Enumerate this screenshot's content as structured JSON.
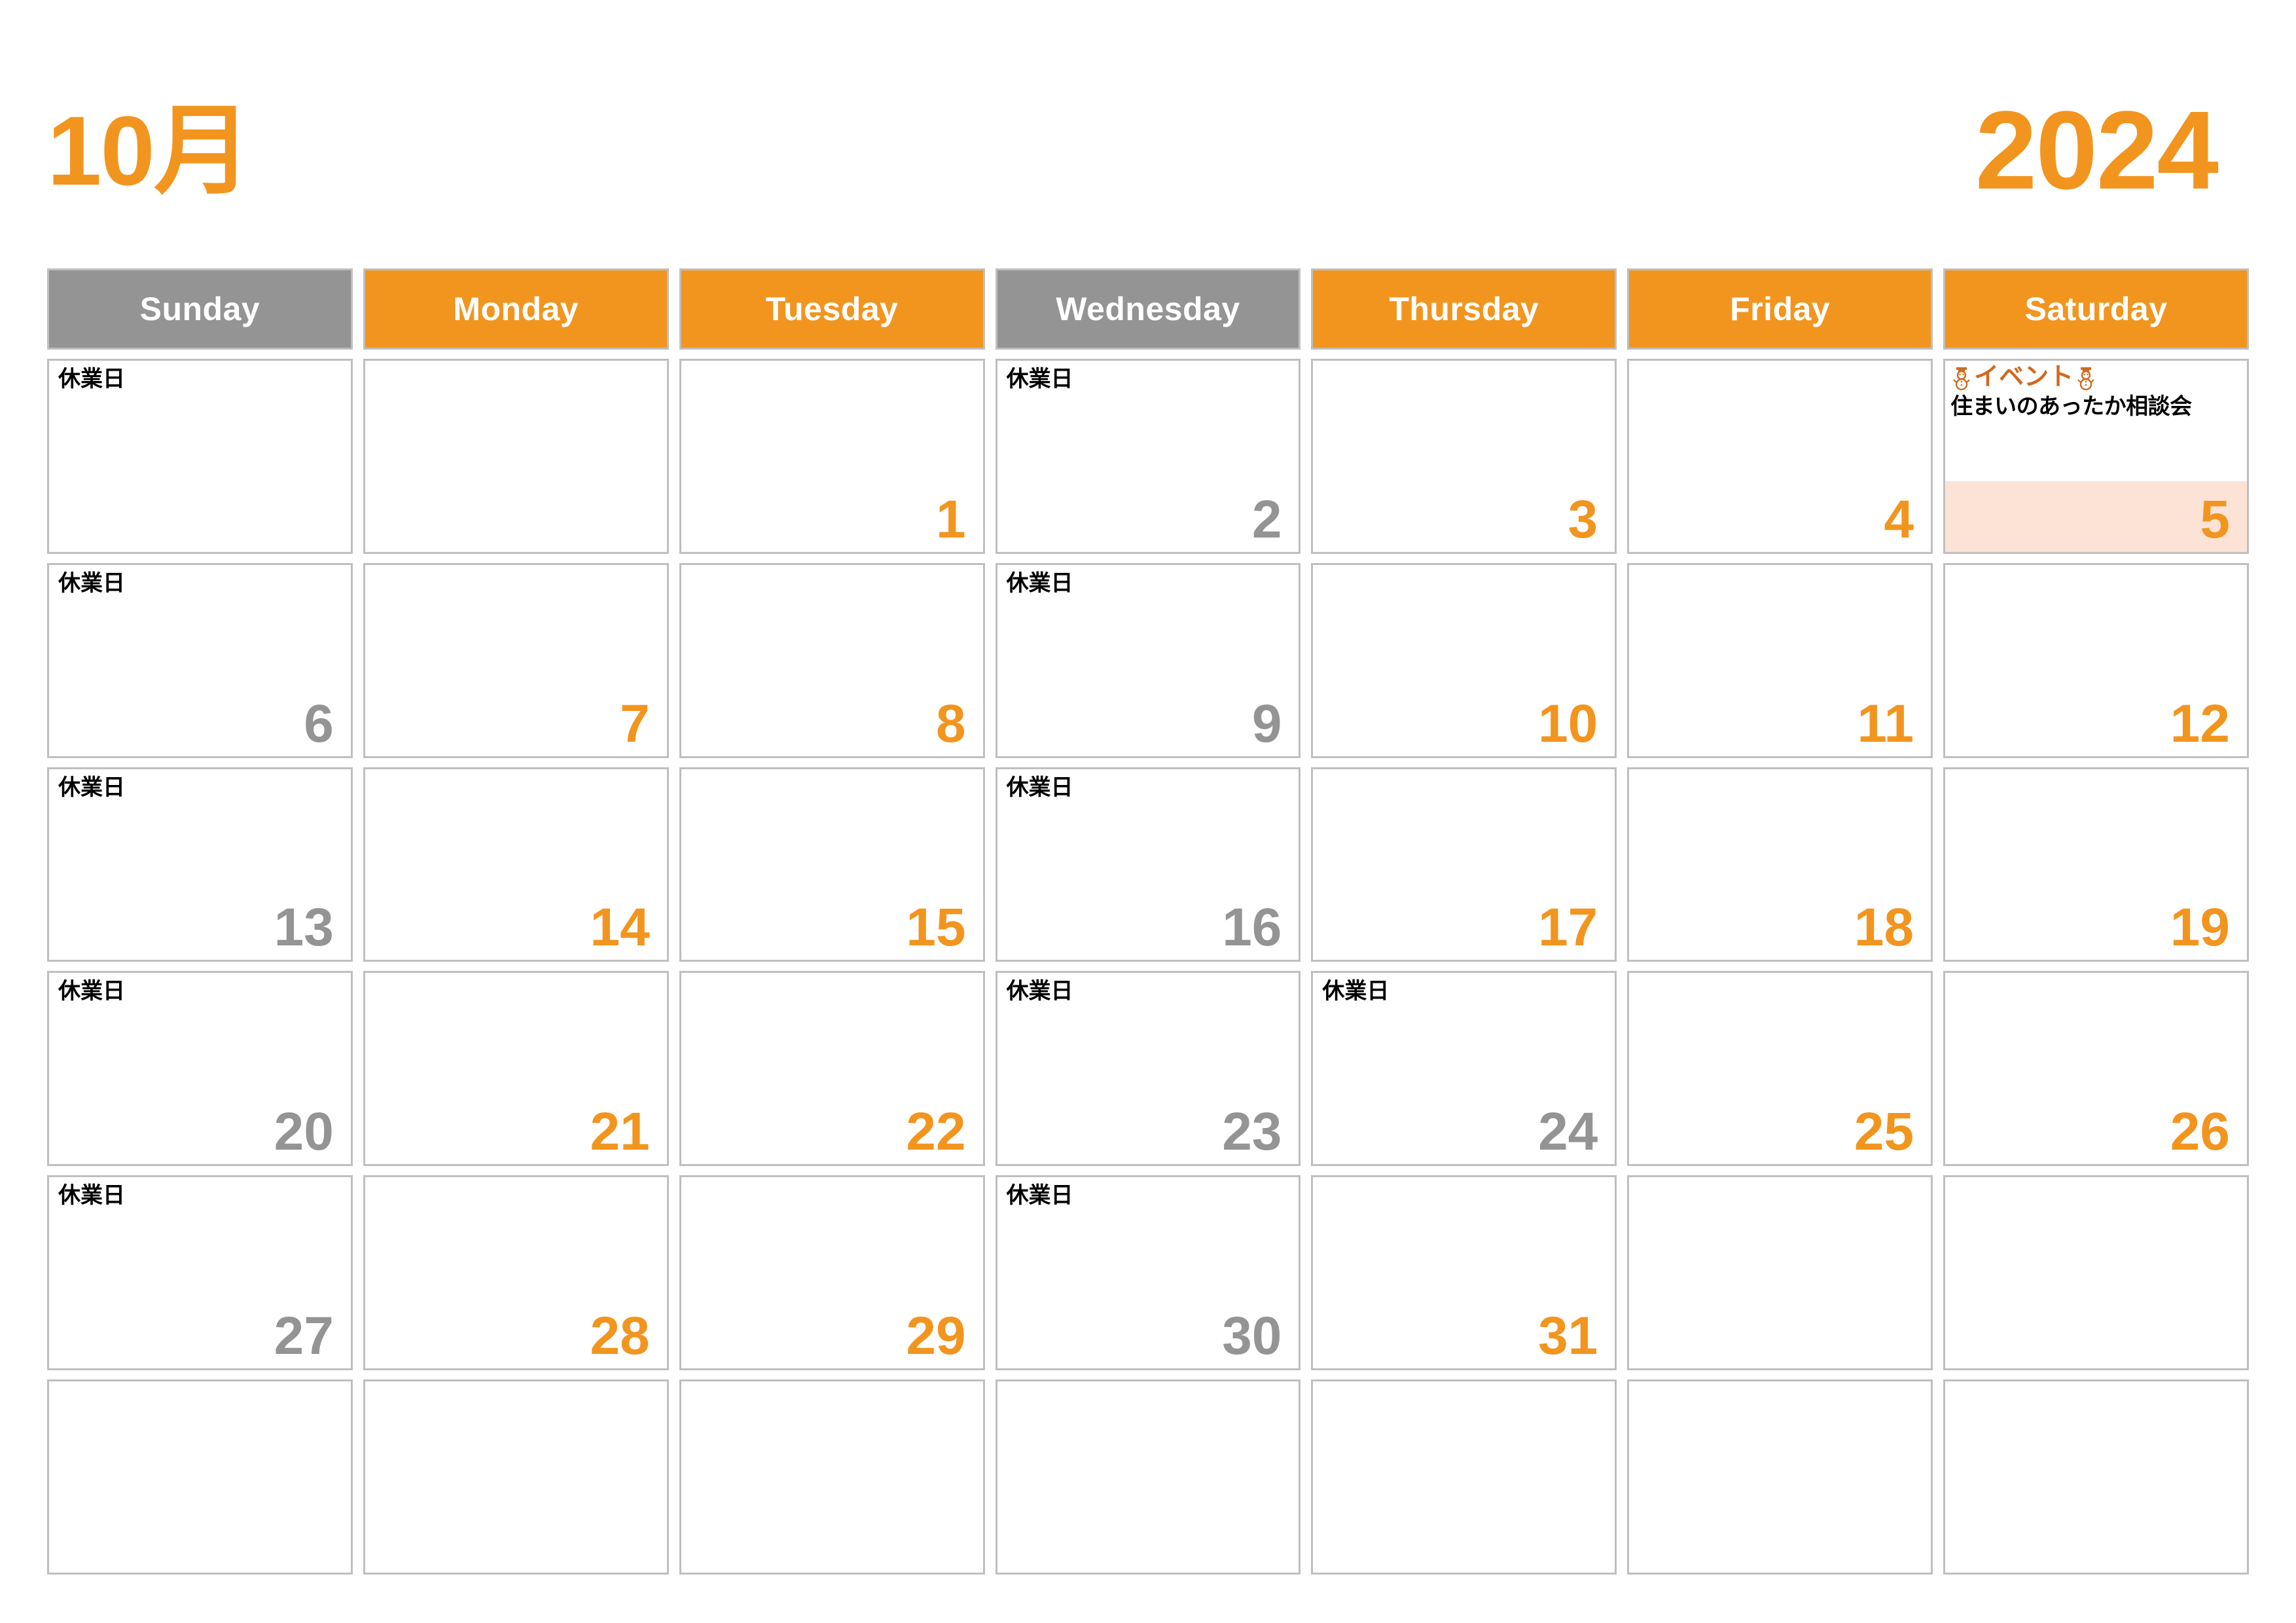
{
  "header": {
    "month_label": "10月",
    "year_label": "2024"
  },
  "weekdays": [
    {
      "label": "Sunday",
      "state": "closed"
    },
    {
      "label": "Monday",
      "state": "open"
    },
    {
      "label": "Tuesday",
      "state": "open"
    },
    {
      "label": "Wednesday",
      "state": "closed"
    },
    {
      "label": "Thursday",
      "state": "open"
    },
    {
      "label": "Friday",
      "state": "open"
    },
    {
      "label": "Saturday",
      "state": "open"
    }
  ],
  "labels": {
    "closed_day": "休業日",
    "event_tag": "イベント",
    "snowman_icon": "snowman-icon"
  },
  "colors": {
    "accent_orange": "#F2951F",
    "closed_gray": "#949494",
    "event_bg": "#FCE3D6",
    "event_tag_color": "#D2691E",
    "cell_border": "#BFBFBF"
  },
  "weeks": [
    [
      {
        "date": "",
        "color": "",
        "closed": true,
        "event": null
      },
      {
        "date": "",
        "color": "",
        "closed": false,
        "event": null
      },
      {
        "date": "1",
        "color": "orange",
        "closed": false,
        "event": null
      },
      {
        "date": "2",
        "color": "gray",
        "closed": true,
        "event": null
      },
      {
        "date": "3",
        "color": "orange",
        "closed": false,
        "event": null
      },
      {
        "date": "4",
        "color": "orange",
        "closed": false,
        "event": null
      },
      {
        "date": "5",
        "color": "orange",
        "closed": false,
        "event": {
          "tag": "イベント",
          "title": "住まいのあったか相談会"
        }
      }
    ],
    [
      {
        "date": "6",
        "color": "gray",
        "closed": true,
        "event": null
      },
      {
        "date": "7",
        "color": "orange",
        "closed": false,
        "event": null
      },
      {
        "date": "8",
        "color": "orange",
        "closed": false,
        "event": null
      },
      {
        "date": "9",
        "color": "gray",
        "closed": true,
        "event": null
      },
      {
        "date": "10",
        "color": "orange",
        "closed": false,
        "event": null
      },
      {
        "date": "11",
        "color": "orange",
        "closed": false,
        "event": null
      },
      {
        "date": "12",
        "color": "orange",
        "closed": false,
        "event": null
      }
    ],
    [
      {
        "date": "13",
        "color": "gray",
        "closed": true,
        "event": null
      },
      {
        "date": "14",
        "color": "orange",
        "closed": false,
        "event": null
      },
      {
        "date": "15",
        "color": "orange",
        "closed": false,
        "event": null
      },
      {
        "date": "16",
        "color": "gray",
        "closed": true,
        "event": null
      },
      {
        "date": "17",
        "color": "orange",
        "closed": false,
        "event": null
      },
      {
        "date": "18",
        "color": "orange",
        "closed": false,
        "event": null
      },
      {
        "date": "19",
        "color": "orange",
        "closed": false,
        "event": null
      }
    ],
    [
      {
        "date": "20",
        "color": "gray",
        "closed": true,
        "event": null
      },
      {
        "date": "21",
        "color": "orange",
        "closed": false,
        "event": null
      },
      {
        "date": "22",
        "color": "orange",
        "closed": false,
        "event": null
      },
      {
        "date": "23",
        "color": "gray",
        "closed": true,
        "event": null
      },
      {
        "date": "24",
        "color": "gray",
        "closed": true,
        "event": null
      },
      {
        "date": "25",
        "color": "orange",
        "closed": false,
        "event": null
      },
      {
        "date": "26",
        "color": "orange",
        "closed": false,
        "event": null
      }
    ],
    [
      {
        "date": "27",
        "color": "gray",
        "closed": true,
        "event": null
      },
      {
        "date": "28",
        "color": "orange",
        "closed": false,
        "event": null
      },
      {
        "date": "29",
        "color": "orange",
        "closed": false,
        "event": null
      },
      {
        "date": "30",
        "color": "gray",
        "closed": true,
        "event": null
      },
      {
        "date": "31",
        "color": "orange",
        "closed": false,
        "event": null
      },
      {
        "date": "",
        "color": "",
        "closed": false,
        "event": null
      },
      {
        "date": "",
        "color": "",
        "closed": false,
        "event": null
      }
    ],
    [
      {
        "date": "",
        "color": "",
        "closed": false,
        "event": null
      },
      {
        "date": "",
        "color": "",
        "closed": false,
        "event": null
      },
      {
        "date": "",
        "color": "",
        "closed": false,
        "event": null
      },
      {
        "date": "",
        "color": "",
        "closed": false,
        "event": null
      },
      {
        "date": "",
        "color": "",
        "closed": false,
        "event": null
      },
      {
        "date": "",
        "color": "",
        "closed": false,
        "event": null
      },
      {
        "date": "",
        "color": "",
        "closed": false,
        "event": null
      }
    ]
  ]
}
